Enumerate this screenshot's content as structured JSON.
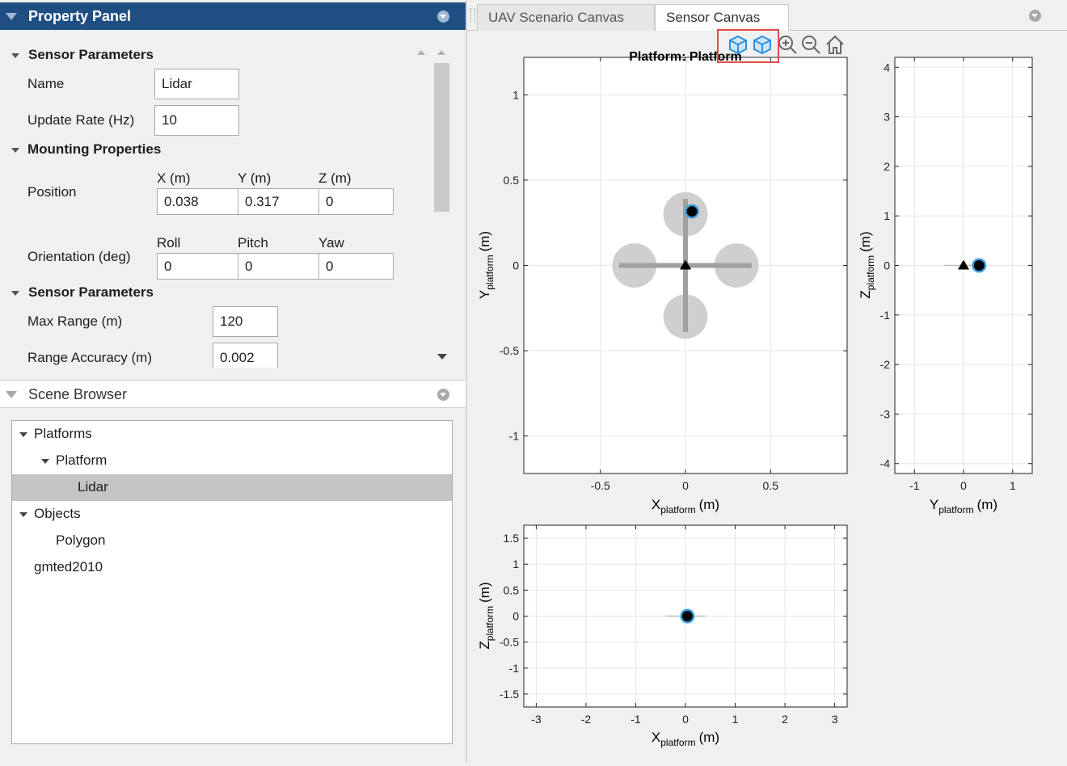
{
  "property_panel": {
    "title": "Property Panel",
    "sensor_params": {
      "title": "Sensor Parameters",
      "name_label": "Name",
      "name_value": "Lidar",
      "update_rate_label": "Update Rate (Hz)",
      "update_rate_value": "10"
    },
    "mounting": {
      "title": "Mounting Properties",
      "position_label": "Position",
      "x_label": "X (m)",
      "y_label": "Y (m)",
      "z_label": "Z (m)",
      "x_value": "0.038",
      "y_value": "0.317",
      "z_value": "0",
      "orientation_label": "Orientation (deg)",
      "roll_label": "Roll",
      "pitch_label": "Pitch",
      "yaw_label": "Yaw",
      "roll_value": "0",
      "pitch_value": "0",
      "yaw_value": "0"
    },
    "sensor_params2": {
      "title": "Sensor Parameters",
      "max_range_label": "Max Range (m)",
      "max_range_value": "120",
      "range_accuracy_label": "Range Accuracy (m)",
      "range_accuracy_value": "0.002"
    }
  },
  "scene_browser": {
    "title": "Scene Browser",
    "items": [
      {
        "label": "Platforms",
        "level": 0,
        "expanded": true
      },
      {
        "label": "Platform",
        "level": 1,
        "expanded": true
      },
      {
        "label": "Lidar",
        "level": 2,
        "selected": true
      },
      {
        "label": "Objects",
        "level": 0,
        "expanded": true
      },
      {
        "label": "Polygon",
        "level": 1
      },
      {
        "label": "gmted2010",
        "level": 0
      }
    ]
  },
  "tabs": {
    "uav": "UAV Scenario Canvas",
    "sensor": "Sensor Canvas",
    "active": "Sensor Canvas"
  },
  "toolbar": {
    "icons": [
      "cube-view-icon",
      "cube-rotate-icon",
      "zoom-in-icon",
      "zoom-out-icon",
      "home-icon"
    ]
  },
  "colors": {
    "header_bg": "#1f4f82",
    "selection_bg": "#c4c4c4",
    "sensor_marker_edge": "#3aa0e0",
    "highlight_box": "#e34a4a",
    "toolbar_icon": "#2d8fe0"
  },
  "chart_data": [
    {
      "type": "scatter",
      "view": "top",
      "title": "Platform: Platform",
      "xlabel": "X",
      "xlabel_sub": "platform",
      "xlabel_unit": "(m)",
      "ylabel": "Y",
      "ylabel_sub": "platform",
      "ylabel_unit": "(m)",
      "xlim": [
        -0.95,
        0.95
      ],
      "ylim": [
        -1.22,
        1.22
      ],
      "xticks": [
        -0.5,
        0,
        0.5
      ],
      "xtick_labels": [
        "-0.5",
        "0",
        "0.5"
      ],
      "yticks": [
        -1,
        -0.5,
        0,
        0.5,
        1
      ],
      "ytick_labels": [
        "-1",
        "-0.5",
        "0",
        "0.5",
        "1"
      ],
      "grid": true,
      "platform": {
        "x": 0,
        "y": 0
      },
      "sensor": {
        "x": 0.038,
        "y": 0.317
      }
    },
    {
      "type": "scatter",
      "view": "side",
      "xlabel": "Y",
      "xlabel_sub": "platform",
      "xlabel_unit": "(m)",
      "ylabel": "Z",
      "ylabel_sub": "platform",
      "ylabel_unit": "(m)",
      "xlim": [
        -1.4,
        1.4
      ],
      "ylim": [
        -4.2,
        4.2
      ],
      "xticks": [
        -1,
        0,
        1
      ],
      "xtick_labels": [
        "-1",
        "0",
        "1"
      ],
      "yticks": [
        -4,
        -3,
        -2,
        -1,
        0,
        1,
        2,
        3,
        4
      ],
      "ytick_labels": [
        "-4",
        "-3",
        "-2",
        "-1",
        "0",
        "1",
        "2",
        "3",
        "4"
      ],
      "grid": true,
      "platform": {
        "x": 0,
        "y": 0
      },
      "sensor": {
        "x": 0.317,
        "y": 0
      }
    },
    {
      "type": "scatter",
      "view": "front",
      "xlabel": "X",
      "xlabel_sub": "platform",
      "xlabel_unit": "(m)",
      "ylabel": "Z",
      "ylabel_sub": "platform",
      "ylabel_unit": "(m)",
      "xlim": [
        -3.25,
        3.25
      ],
      "ylim": [
        -1.75,
        1.75
      ],
      "xticks": [
        -3,
        -2,
        -1,
        0,
        1,
        2,
        3
      ],
      "xtick_labels": [
        "-3",
        "-2",
        "-1",
        "0",
        "1",
        "2",
        "3"
      ],
      "yticks": [
        -1.5,
        -1,
        -0.5,
        0,
        0.5,
        1,
        1.5
      ],
      "ytick_labels": [
        "-1.5",
        "-1",
        "-0.5",
        "0",
        "0.5",
        "1",
        "1.5"
      ],
      "grid": true,
      "sensor": {
        "x": 0.038,
        "y": 0
      }
    }
  ]
}
